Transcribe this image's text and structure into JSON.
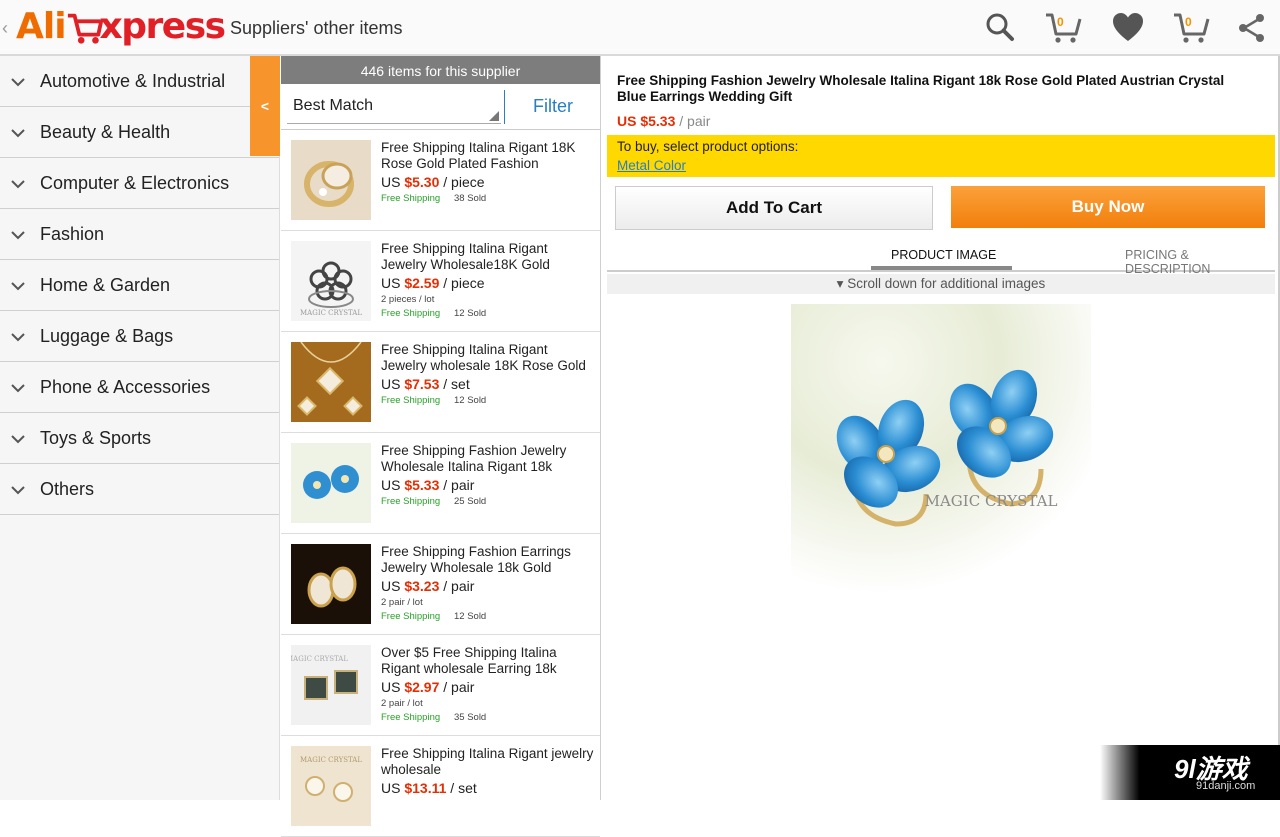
{
  "app": {
    "logo_ali": "Ali",
    "logo_xpress": "xpress",
    "title": "Suppliers' other items",
    "cart_badge_1": "0",
    "cart_badge_2": "0"
  },
  "sidebar": {
    "collapse_label": "<",
    "items": [
      {
        "label": "Automotive & Industrial"
      },
      {
        "label": "Beauty & Health"
      },
      {
        "label": "Computer & Electronics"
      },
      {
        "label": "Fashion"
      },
      {
        "label": "Home & Garden"
      },
      {
        "label": "Luggage & Bags"
      },
      {
        "label": "Phone & Accessories"
      },
      {
        "label": "Toys & Sports"
      },
      {
        "label": "Others"
      }
    ]
  },
  "list": {
    "count_text": "446 items for this supplier",
    "sort_value": "Best Match",
    "filter_label": "Filter",
    "products": [
      {
        "title": "Free Shipping  Italina Rigant 18K Rose Gold Plated Fashion",
        "currency": "US",
        "price": "$5.30",
        "unit": "/ piece",
        "lot": "",
        "shipping": "Free Shipping",
        "sold": "38 Sold"
      },
      {
        "title": "Free Shipping Italina Rigant Jewelry Wholesale18K Gold",
        "currency": "US",
        "price": "$2.59",
        "unit": "/ piece",
        "lot": "2 pieces / lot",
        "shipping": "Free Shipping",
        "sold": "12 Sold"
      },
      {
        "title": "Free Shipping Italina Rigant Jewelry wholesale 18K Rose Gold",
        "currency": "US",
        "price": "$7.53",
        "unit": "/ set",
        "lot": "",
        "shipping": "Free Shipping",
        "sold": "12 Sold"
      },
      {
        "title": "Free Shipping Fashion Jewelry Wholesale Italina Rigant 18k",
        "currency": "US",
        "price": "$5.33",
        "unit": "/ pair",
        "lot": "",
        "shipping": "Free Shipping",
        "sold": "25 Sold"
      },
      {
        "title": "Free Shipping Fashion Earrings Jewelry Wholesale 18k Gold",
        "currency": "US",
        "price": "$3.23",
        "unit": "/ pair",
        "lot": "2 pair / lot",
        "shipping": "Free Shipping",
        "sold": "12 Sold"
      },
      {
        "title": "Over $5  Free Shipping Italina Rigant wholesale Earring 18k",
        "currency": "US",
        "price": "$2.97",
        "unit": "/ pair",
        "lot": "2 pair / lot",
        "shipping": "Free Shipping",
        "sold": "35 Sold"
      },
      {
        "title": "Free Shipping Italina Rigant jewelry wholesale",
        "currency": "US",
        "price": "$13.11",
        "unit": "/ set",
        "lot": "",
        "shipping": "",
        "sold": ""
      }
    ]
  },
  "detail": {
    "title": "Free Shipping Fashion Jewelry Wholesale Italina Rigant 18k Rose Gold Plated Austrian Crystal  Blue Earrings  Wedding Gift",
    "currency": "US",
    "price": "$5.33",
    "unit": "/ pair",
    "options_label": "To buy, select product options:",
    "options_link": "Metal Color",
    "add_to_cart": "Add To Cart",
    "buy_now": "Buy Now",
    "tab_product_image": "PRODUCT IMAGE",
    "tab_pricing": "PRICING & DESCRIPTION",
    "scroll_hint": "▾ Scroll down for additional images",
    "image_watermark": "MAGIC CRYSTAL"
  },
  "watermark": {
    "main": "9l游戏",
    "sub": "91danji.com"
  },
  "colors": {
    "brand_orange": "#f7942b",
    "price_red": "#e62e04",
    "link_blue": "#2a7fc1",
    "options_yellow": "#ffd800",
    "shipping_green": "#2aa12a"
  },
  "icons": [
    "back-caret-icon",
    "search-icon",
    "cart-icon",
    "heart-icon",
    "share-icon",
    "chevron-down-icon"
  ]
}
